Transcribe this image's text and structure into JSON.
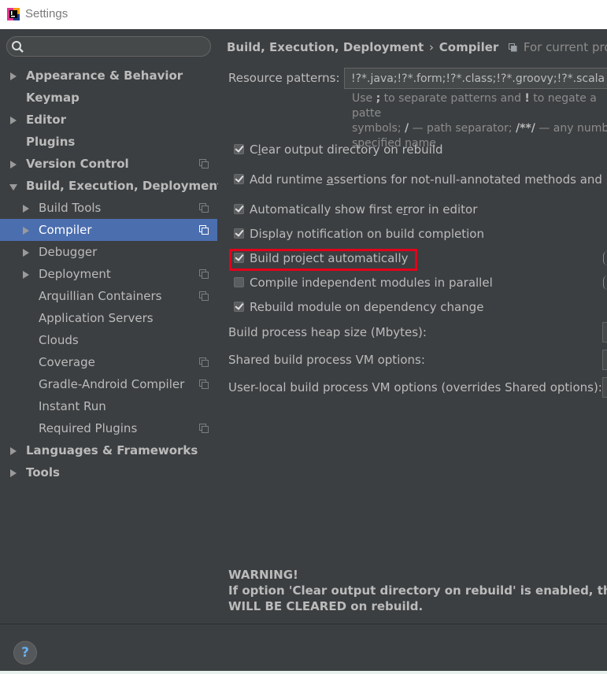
{
  "window": {
    "title": "Settings",
    "icon": "intellij-app-icon"
  },
  "search": {
    "placeholder": "",
    "value": ""
  },
  "sidebar": {
    "items": [
      {
        "label": "Appearance & Behavior",
        "name": "sidebar-item-appearance-behavior",
        "level": 0,
        "arrow": "collapsed",
        "bold": true,
        "project": false,
        "selected": false
      },
      {
        "label": "Keymap",
        "name": "sidebar-item-keymap",
        "level": 0,
        "arrow": "none",
        "bold": true,
        "project": false,
        "selected": false
      },
      {
        "label": "Editor",
        "name": "sidebar-item-editor",
        "level": 0,
        "arrow": "collapsed",
        "bold": true,
        "project": false,
        "selected": false
      },
      {
        "label": "Plugins",
        "name": "sidebar-item-plugins",
        "level": 0,
        "arrow": "none",
        "bold": true,
        "project": false,
        "selected": false
      },
      {
        "label": "Version Control",
        "name": "sidebar-item-version-control",
        "level": 0,
        "arrow": "collapsed",
        "bold": true,
        "project": true,
        "selected": false
      },
      {
        "label": "Build, Execution, Deployment",
        "name": "sidebar-item-build-execution-deployment",
        "level": 0,
        "arrow": "expanded",
        "bold": true,
        "project": false,
        "selected": false
      },
      {
        "label": "Build Tools",
        "name": "sidebar-item-build-tools",
        "level": 1,
        "arrow": "collapsed",
        "bold": false,
        "project": true,
        "selected": false
      },
      {
        "label": "Compiler",
        "name": "sidebar-item-compiler",
        "level": 1,
        "arrow": "collapsed",
        "bold": false,
        "project": true,
        "selected": true
      },
      {
        "label": "Debugger",
        "name": "sidebar-item-debugger",
        "level": 1,
        "arrow": "collapsed",
        "bold": false,
        "project": false,
        "selected": false
      },
      {
        "label": "Deployment",
        "name": "sidebar-item-deployment",
        "level": 1,
        "arrow": "collapsed",
        "bold": false,
        "project": true,
        "selected": false
      },
      {
        "label": "Arquillian Containers",
        "name": "sidebar-item-arquillian-containers",
        "level": 1,
        "arrow": "none",
        "bold": false,
        "project": true,
        "selected": false
      },
      {
        "label": "Application Servers",
        "name": "sidebar-item-application-servers",
        "level": 1,
        "arrow": "none",
        "bold": false,
        "project": false,
        "selected": false
      },
      {
        "label": "Clouds",
        "name": "sidebar-item-clouds",
        "level": 1,
        "arrow": "none",
        "bold": false,
        "project": false,
        "selected": false
      },
      {
        "label": "Coverage",
        "name": "sidebar-item-coverage",
        "level": 1,
        "arrow": "none",
        "bold": false,
        "project": true,
        "selected": false
      },
      {
        "label": "Gradle-Android Compiler",
        "name": "sidebar-item-gradle-android-compiler",
        "level": 1,
        "arrow": "none",
        "bold": false,
        "project": true,
        "selected": false
      },
      {
        "label": "Instant Run",
        "name": "sidebar-item-instant-run",
        "level": 1,
        "arrow": "none",
        "bold": false,
        "project": false,
        "selected": false
      },
      {
        "label": "Required Plugins",
        "name": "sidebar-item-required-plugins",
        "level": 1,
        "arrow": "none",
        "bold": false,
        "project": true,
        "selected": false
      },
      {
        "label": "Languages & Frameworks",
        "name": "sidebar-item-languages-frameworks",
        "level": 0,
        "arrow": "collapsed",
        "bold": true,
        "project": false,
        "selected": false
      },
      {
        "label": "Tools",
        "name": "sidebar-item-tools",
        "level": 0,
        "arrow": "collapsed",
        "bold": true,
        "project": false,
        "selected": false
      }
    ]
  },
  "breadcrumb": {
    "path": "Build, Execution, Deployment",
    "separator": "›",
    "current": "Compiler",
    "project_note": "For current project"
  },
  "compiler": {
    "resource_patterns_label": "Resource patterns:",
    "resource_patterns_value": "!?*.java;!?*.form;!?*.class;!?*.groovy;!?*.scala;!",
    "hint_1": "Use ",
    "hint_semicolon": ";",
    "hint_2": " to separate patterns and ",
    "hint_bang": "!",
    "hint_3": " to negate a patte",
    "hint_4": "symbols; ",
    "hint_slash": "/",
    "hint_5": " — path separator; ",
    "hint_glob": "/**/",
    "hint_6": " — any numbe",
    "hint_7": "specified name",
    "options": [
      {
        "label": "Clear output directory on rebuild",
        "mnemonic_index": 1,
        "checked": true,
        "name": "clear-output-checkbox"
      },
      {
        "label": "Add runtime assertions for not-null-annotated methods and pa",
        "mnemonic_index": 12,
        "checked": true,
        "name": "runtime-assertions-checkbox"
      },
      {
        "label": "Automatically show first error in editor",
        "mnemonic_index": 26,
        "checked": true,
        "name": "show-first-error-checkbox"
      },
      {
        "label": "Display notification on build completion",
        "mnemonic_index": -1,
        "checked": true,
        "name": "build-notification-checkbox"
      },
      {
        "label": "Build project automatically",
        "mnemonic_index": -1,
        "checked": true,
        "name": "build-automatically-checkbox"
      },
      {
        "label": "Compile independent modules in parallel",
        "mnemonic_index": -1,
        "checked": false,
        "name": "parallel-compile-checkbox"
      },
      {
        "label": "Rebuild module on dependency change",
        "mnemonic_index": -1,
        "checked": true,
        "name": "rebuild-on-dependency-checkbox"
      }
    ],
    "heap_label": "Build process heap size (Mbytes):",
    "shared_vm_label": "Shared build process VM options:",
    "user_vm_label": "User-local build process VM options (overrides Shared options):",
    "warning_title": "WARNING!",
    "warning_line1": "If option 'Clear output directory on rebuild' is enabled, the entire",
    "warning_line2": "WILL BE CLEARED on rebuild."
  },
  "footer": {
    "help_label": "?"
  },
  "colors": {
    "selection": "#4b6eaf",
    "highlight_box": "#e3001b",
    "background": "#3c3f41",
    "help_accent": "#64aef0"
  }
}
